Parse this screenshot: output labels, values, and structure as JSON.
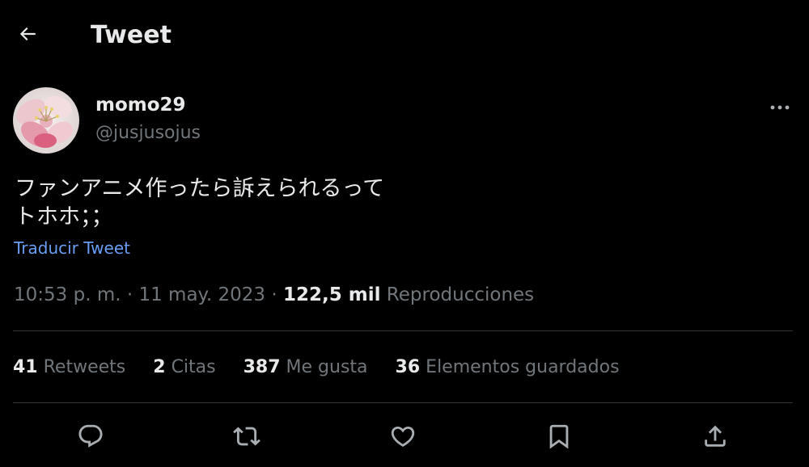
{
  "header": {
    "title": "Tweet",
    "back_icon": "arrow-left-icon"
  },
  "author": {
    "display_name": "momo29",
    "handle": "@jusjusojus",
    "avatar_icon": "pink-blossom-avatar"
  },
  "tweet": {
    "text": "ファンアニメ作ったら訴えられるって\nトホホ；；",
    "translate_label": "Traducir Tweet"
  },
  "meta": {
    "time": "10:53 p. m.",
    "separator": "·",
    "date": "11 may. 2023",
    "views_count": "122,5 mil",
    "views_label": "Reproducciones"
  },
  "stats": [
    {
      "count": "41",
      "label": "Retweets"
    },
    {
      "count": "2",
      "label": "Citas"
    },
    {
      "count": "387",
      "label": "Me gusta"
    },
    {
      "count": "36",
      "label": "Elementos guardados"
    }
  ],
  "actions": [
    {
      "icon": "reply-icon"
    },
    {
      "icon": "retweet-icon"
    },
    {
      "icon": "like-icon"
    },
    {
      "icon": "bookmark-icon"
    },
    {
      "icon": "share-icon"
    }
  ],
  "colors": {
    "background": "#000000",
    "text_primary": "#e7e9ea",
    "text_secondary": "#71767b",
    "link": "#6b9ef5",
    "divider": "#2f3336"
  }
}
